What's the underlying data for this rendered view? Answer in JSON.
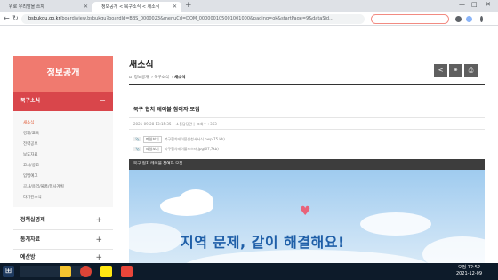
{
  "browser": {
    "tabs": [
      {
        "label": "위로 우리말을 쓰자"
      },
      {
        "label": "정보공개 < 북구소식 < 새소식"
      }
    ],
    "url_host": "bsbukgu.go.kr",
    "url_path": "/board/view.bsbukgu?boardId=BBS_0000023&menuCd=DOM_000000105001001000&paging=ok&startPage=9&dataSid...",
    "window_controls": {
      "minimize": "—",
      "maximize": "□",
      "close": "✕"
    }
  },
  "sidebar": {
    "title": "정보공개",
    "section": "북구소식",
    "items": [
      {
        "label": "새소식",
        "active": true
      },
      {
        "label": "경제/교육"
      },
      {
        "label": "전략공보"
      },
      {
        "label": "보도자료"
      },
      {
        "label": "고시/공고"
      },
      {
        "label": "입법예고"
      },
      {
        "label": "공사/용역/물품/행사계획"
      },
      {
        "label": "타기관소식"
      }
    ],
    "categories": [
      {
        "label": "정책실명제"
      },
      {
        "label": "통계자료"
      },
      {
        "label": "예산방"
      }
    ]
  },
  "main": {
    "title": "새소식",
    "breadcrumb": [
      "정보공개",
      "북구소식",
      "새소식"
    ],
    "post": {
      "title": "북구 협치 테이블 참여자 모집",
      "date": "2021-09-28 13:15:35",
      "dept": "소통담당관",
      "views": "조회수 : 363",
      "attachments": [
        {
          "badge": "파일보기",
          "name": "북구협치테이블신청서서식.hwp(75 kb)"
        },
        {
          "badge": "파일보기",
          "name": "북구협치테이블포스터.jpg(67,7kb)"
        }
      ]
    },
    "poster_header": "북구 협치 테이블 참여자 모집",
    "poster_text": "지역 문제, 같이 해결해요!"
  },
  "taskbar": {
    "time": "오전 12:52",
    "date": "2021-12-09"
  },
  "colors": {
    "accent": "#d9464b",
    "sidebar_title": "#f07a6f",
    "poster_text": "#1f5fa8"
  }
}
